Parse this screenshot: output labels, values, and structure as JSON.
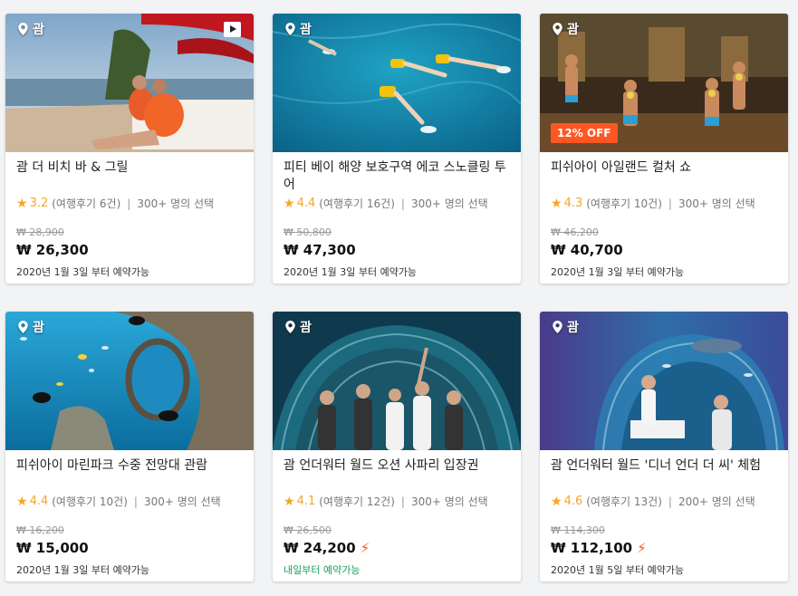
{
  "cards": [
    {
      "location": "괌",
      "title": "괌 더 비치 바 & 그릴",
      "rating": "3.2",
      "reviews": "(여행후기 6건)",
      "sep": "|",
      "chosen": "300+ 명의 선택",
      "original_price": "₩ 28,900",
      "price": "₩ 26,300",
      "availability": "2020년 1월 3일 부터 예약가능",
      "icons": [
        "location-pin-icon",
        "play-video-icon",
        "star-icon"
      ]
    },
    {
      "location": "괌",
      "title": "피티 베이 해양 보호구역 에코 스노클링 투어",
      "rating": "4.4",
      "reviews": "(여행후기 16건)",
      "sep": "|",
      "chosen": "300+ 명의 선택",
      "original_price": "₩ 50,800",
      "price": "₩ 47,300",
      "availability": "2020년 1월 3일 부터 예약가능",
      "icons": [
        "location-pin-icon",
        "star-icon"
      ]
    },
    {
      "location": "괌",
      "badge": "12% OFF",
      "title": "피쉬아이 아일랜드 컬처 쇼",
      "rating": "4.3",
      "reviews": "(여행후기 10건)",
      "sep": "|",
      "chosen": "300+ 명의 선택",
      "original_price": "₩ 46,200",
      "price": "₩ 40,700",
      "availability": "2020년 1월 3일 부터 예약가능",
      "icons": [
        "location-pin-icon",
        "star-icon"
      ]
    },
    {
      "location": "괌",
      "title": "피쉬아이 마린파크 수중 전망대 관람",
      "rating": "4.4",
      "reviews": "(여행후기 10건)",
      "sep": "|",
      "chosen": "300+ 명의 선택",
      "original_price": "₩ 16,200",
      "price": "₩ 15,000",
      "availability": "2020년 1월 3일 부터 예약가능",
      "icons": [
        "location-pin-icon",
        "star-icon"
      ]
    },
    {
      "location": "괌",
      "title": "괌 언더워터 월드 오션 사파리 입장권",
      "rating": "4.1",
      "reviews": "(여행후기 12건)",
      "sep": "|",
      "chosen": "300+ 명의 선택",
      "original_price": "₩ 26,500",
      "price": "₩ 24,200",
      "availability": "내일부터 예약가능",
      "icons": [
        "location-pin-icon",
        "star-icon",
        "lightning-bolt-icon"
      ]
    },
    {
      "location": "괌",
      "title": "괌 언더워터 월드 '디너 언더 더 씨' 체험",
      "rating": "4.6",
      "reviews": "(여행후기 13건)",
      "sep": "|",
      "chosen": "200+ 명의 선택",
      "original_price": "₩ 114,300",
      "price": "₩ 112,100",
      "availability": "2020년 1월 5일 부터 예약가능",
      "icons": [
        "location-pin-icon",
        "star-icon",
        "lightning-bolt-icon"
      ]
    }
  ],
  "colors": {
    "star": "#f5a623",
    "badge": "#ff5722",
    "bolt": "#ff5722",
    "availability_green": "#19a15f",
    "background": "#f2f3f5"
  }
}
